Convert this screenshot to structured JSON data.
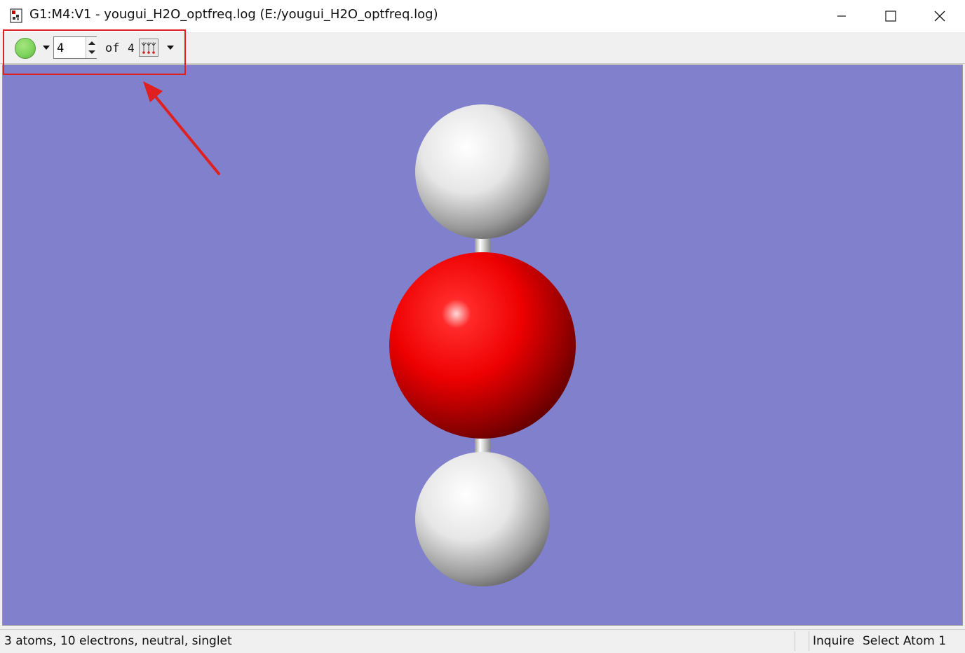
{
  "window": {
    "title": "G1:M4:V1 - yougui_H2O_optfreq.log (E:/yougui_H2O_optfreq.log)",
    "icon": "gaussview-document-icon"
  },
  "toolbar": {
    "color_indicator": "#7fd45e",
    "frame_value": "4",
    "of_label": "of",
    "total_frames": "4",
    "vibration_icon": "vibration-icon"
  },
  "viewport": {
    "background": "#8080cc",
    "atoms": [
      {
        "element": "H",
        "color": "#ffffff"
      },
      {
        "element": "O",
        "color": "#ff0000"
      },
      {
        "element": "H",
        "color": "#ffffff"
      }
    ]
  },
  "annotation": {
    "box_color": "#e02020"
  },
  "status": {
    "info": "3 atoms, 10 electrons, neutral, singlet",
    "mode": "Inquire",
    "action": "Select Atom 1"
  }
}
